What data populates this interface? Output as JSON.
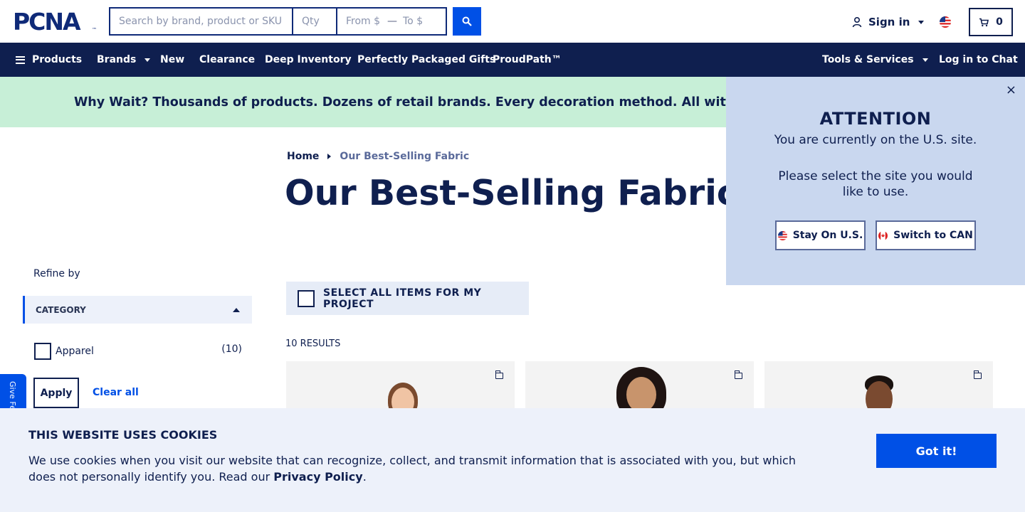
{
  "header": {
    "logo_text": "PCNA",
    "logo_tm": "™",
    "search": {
      "placeholder": "Search by brand, product or SKU",
      "qty_placeholder": "Qty",
      "from_placeholder": "From $",
      "dash": "—",
      "to_placeholder": "To $"
    },
    "sign_in": "Sign in",
    "cart_count": "0"
  },
  "nav": {
    "products": "Products",
    "brands": "Brands",
    "new": "New",
    "clearance": "Clearance",
    "deep_inventory": "Deep Inventory",
    "gifts": "Perfectly Packaged Gifts",
    "proudpath": "ProudPath™",
    "tools": "Tools & Services",
    "chat": "Log in to Chat"
  },
  "promo": {
    "text": "Why Wait? Thousands of products. Dozens of retail brands. Every decoration method. All with a standard"
  },
  "breadcrumb": {
    "home": "Home",
    "current": "Our Best-Selling Fabric"
  },
  "page_title": "Our Best-Selling Fabric",
  "sidebar": {
    "refine_by": "Refine by",
    "category_header": "CATEGORY",
    "categories": [
      {
        "label": "Apparel",
        "count": "(10)"
      }
    ],
    "apply": "Apply",
    "clear_all": "Clear all",
    "feedback": "Give Fe"
  },
  "main": {
    "select_all": "SELECT ALL ITEMS FOR MY PROJECT",
    "results": "10 RESULTS"
  },
  "attention": {
    "close": "×",
    "title": "ATTENTION",
    "message": "You are currently on the U.S. site.",
    "prompt": "Please select the site you would like to use.",
    "stay_us": "Stay On U.S.",
    "switch_can": "Switch to CAN"
  },
  "cookie": {
    "title": "THIS WEBSITE USES COOKIES",
    "text": "We use cookies when you visit our website that can recognize, collect, and transmit information that is associated with you, but which does not personally identify you. Read our",
    "link": "Privacy Policy",
    "period": ".",
    "button": "Got it!"
  },
  "colors": {
    "navy": "#0f1f4f",
    "brand_blue": "#0050e6",
    "promo_green": "#c7efd7",
    "popup_blue": "#c9d7ef",
    "cookie_bg": "#edf1fa"
  }
}
